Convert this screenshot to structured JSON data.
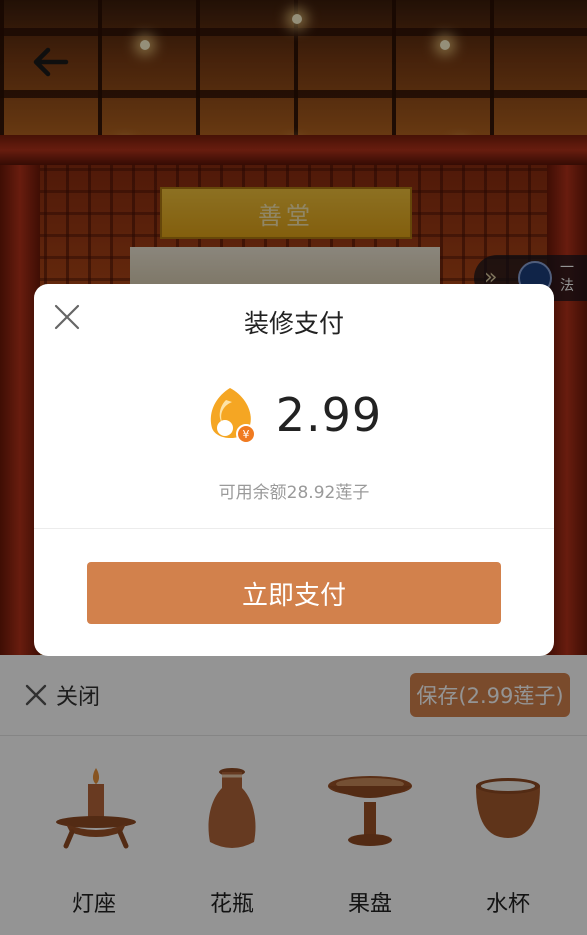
{
  "scene": {
    "plaque_text": "善堂",
    "side_widget_text": "一法"
  },
  "modal": {
    "title": "装修支付",
    "coin_icon": "lotus-seed-coin-icon",
    "amount": "2.99",
    "balance_text": "可用余额28.92莲子",
    "pay_button": "立即支付"
  },
  "panel": {
    "close_label": "关闭",
    "save_label": "保存(2.99莲子)",
    "items": [
      {
        "label": "灯座",
        "icon": "candle-holder-icon"
      },
      {
        "label": "花瓶",
        "icon": "vase-icon"
      },
      {
        "label": "果盘",
        "icon": "fruit-plate-icon"
      },
      {
        "label": "水杯",
        "icon": "water-cup-icon"
      }
    ]
  },
  "colors": {
    "accent": "#d2814c",
    "coin": "#f5a623"
  }
}
